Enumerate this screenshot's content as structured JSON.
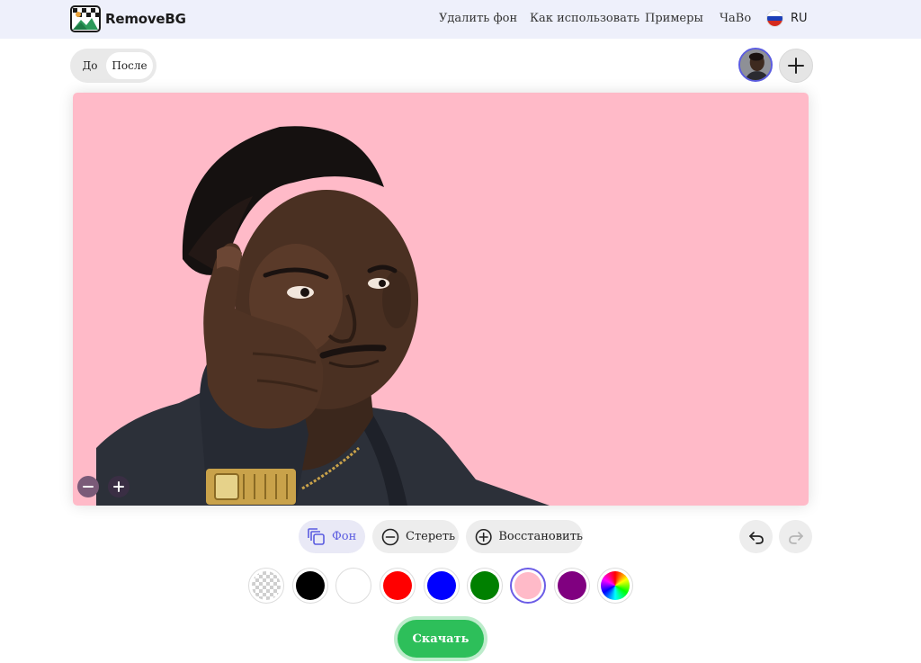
{
  "header": {
    "logo_text": "RemoveBG",
    "nav": [
      "Удалить фон",
      "Как использовать",
      "Примеры",
      "ЧаВо"
    ],
    "language": "RU"
  },
  "view_toggle": {
    "before": "До",
    "after": "После",
    "selected": "После"
  },
  "editor": {
    "tools": {
      "background": "Фон",
      "erase": "Стереть",
      "restore": "Восстановить"
    },
    "selected_tool": "Фон",
    "canvas_background": "#FFBAC8",
    "icons": {
      "zoom_out": "minus-icon",
      "zoom_in": "plus-icon",
      "background": "layers-icon",
      "erase": "minus-circle-icon",
      "restore": "plus-circle-icon",
      "undo": "undo-icon",
      "redo": "redo-icon",
      "add_image": "plus-icon"
    }
  },
  "swatches": [
    {
      "name": "transparent",
      "color": "checkerboard"
    },
    {
      "name": "black",
      "color": "#000000"
    },
    {
      "name": "white",
      "color": "#FFFFFF"
    },
    {
      "name": "red",
      "color": "#FF0000"
    },
    {
      "name": "blue",
      "color": "#0000FF"
    },
    {
      "name": "green",
      "color": "#008000"
    },
    {
      "name": "pink",
      "color": "#FFBAC8",
      "selected": true
    },
    {
      "name": "purple",
      "color": "#800080"
    },
    {
      "name": "custom",
      "color": "rainbow"
    }
  ],
  "download_label": "Скачать",
  "colors": {
    "accent": "#5B5CE0",
    "download": "#2DBF5A",
    "header_bg": "#EEF0FB"
  }
}
